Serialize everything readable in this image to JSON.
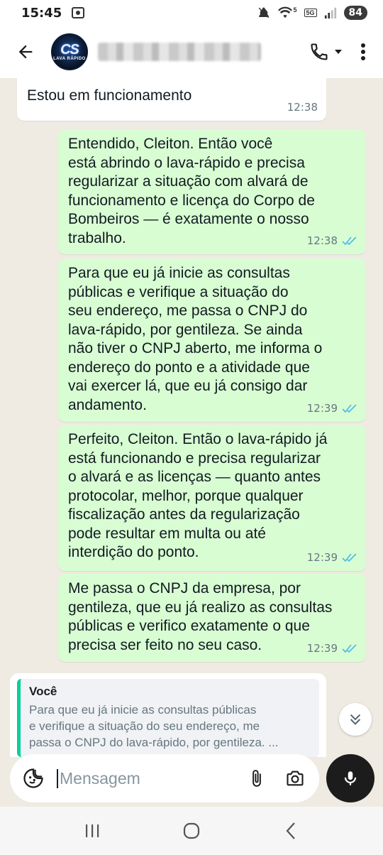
{
  "status_bar": {
    "time": "15:45",
    "battery": "84",
    "wifi_badge": "5",
    "net_badge": "5G"
  },
  "header": {
    "avatar_text": "CS",
    "avatar_subtext": "LAVA RÁPIDO",
    "icons": [
      "back-arrow-icon",
      "phone-icon",
      "chevron-down-icon",
      "more-vert-icon"
    ]
  },
  "messages": [
    {
      "direction": "incoming",
      "text": "Estou em funcionamento",
      "time": "12:38"
    },
    {
      "direction": "outgoing",
      "text": "Entendido, Cleiton. Então você\nestá abrindo o lava-rápido e precisa\nregularizar a situação com alvará de\nfuncionamento e licença do Corpo de\nBombeiros — é exatamente o nosso\ntrabalho.",
      "time": "12:38",
      "read": true
    },
    {
      "direction": "outgoing",
      "text": "Para que eu já inicie as consultas\npúblicas e verifique a situação do\nseu endereço, me passa o CNPJ do\nlava-rápido, por gentileza. Se ainda\nnão tiver o CNPJ aberto, me informa o\nendereço do ponto e a atividade que\nvai exercer lá, que eu já consigo dar\nandamento.",
      "time": "12:39",
      "read": true
    },
    {
      "direction": "outgoing",
      "text": "Perfeito, Cleiton. Então o lava-rápido já\nestá funcionando e precisa regularizar\no alvará e as licenças — quanto antes\nprotocolar, melhor, porque qualquer\nfiscalização antes da regularização\npode resultar em multa ou até\ninterdição do ponto.",
      "time": "12:39",
      "read": true
    },
    {
      "direction": "outgoing",
      "text": "Me passa o CNPJ da empresa, por\ngentileza, que eu já realizo as consultas\npúblicas e verifico exatamente o que\nprecisa ser feito no seu caso.",
      "time": "12:39",
      "read": true
    }
  ],
  "reply_preview": {
    "author": "Você",
    "text": "Para que eu já inicie as consultas públicas\ne verifique a situação do seu endereço, me\npassa o CNPJ do lava-rápido, por gentileza. ..."
  },
  "input": {
    "placeholder": "Mensagem",
    "value": ""
  },
  "colors": {
    "outgoing_bubble": "#d9fdd3",
    "incoming_bubble": "#ffffff",
    "chat_background": "#efeae2",
    "read_ticks": "#53bdeb",
    "mic_button": "#1c1c1c"
  }
}
